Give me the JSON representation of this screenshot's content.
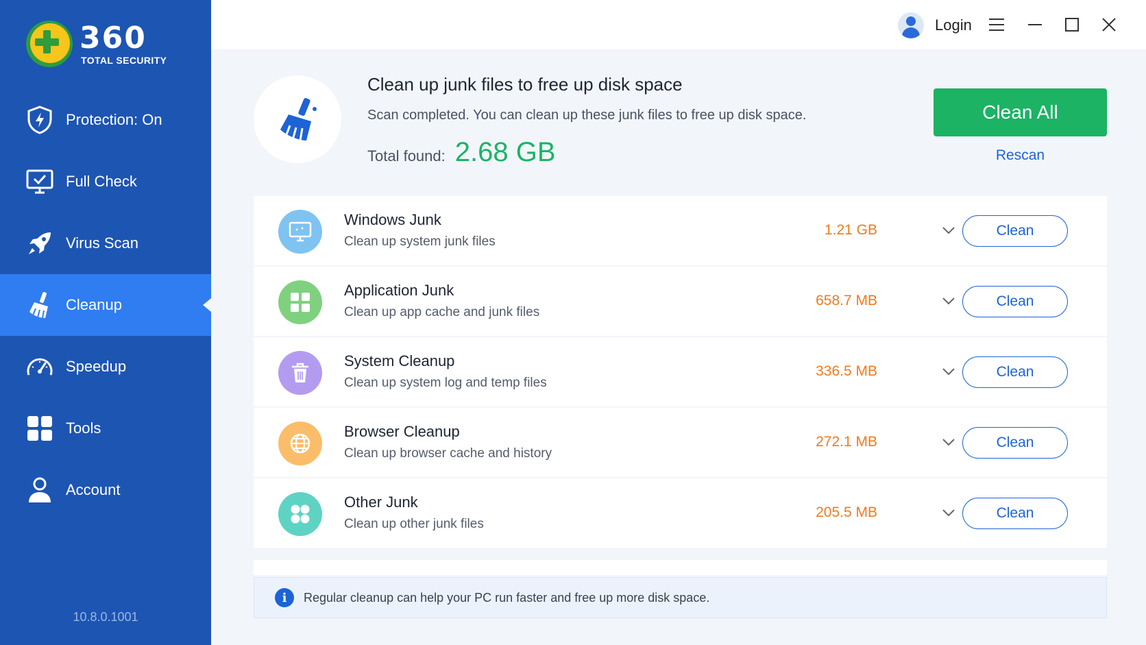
{
  "app": {
    "logo_number": "360",
    "logo_subtitle": "TOTAL SECURITY",
    "version": "10.8.0.1001"
  },
  "sidebar": {
    "items": [
      {
        "label": "Protection: On",
        "icon": "shield-bolt-icon",
        "active": false
      },
      {
        "label": "Full Check",
        "icon": "monitor-check-icon",
        "active": false
      },
      {
        "label": "Virus Scan",
        "icon": "rocket-icon",
        "active": false
      },
      {
        "label": "Cleanup",
        "icon": "broom-icon",
        "active": true
      },
      {
        "label": "Speedup",
        "icon": "speedometer-icon",
        "active": false
      },
      {
        "label": "Tools",
        "icon": "grid-icon",
        "active": false
      },
      {
        "label": "Account",
        "icon": "user-icon",
        "active": false
      }
    ]
  },
  "topbar": {
    "login_label": "Login"
  },
  "hero": {
    "title": "Clean up junk files to free up disk space",
    "description": "Scan completed. You can clean up these junk files to free up disk space.",
    "found_label": "Total found:",
    "found_value": "2.68 GB",
    "clean_all_label": "Clean All",
    "rescan_label": "Rescan"
  },
  "junk_list": [
    {
      "title": "Windows Junk",
      "description": "Clean up system junk files",
      "size": "1.21 GB",
      "button": "Clean",
      "icon": "monitor-icon",
      "color": "#7ec3f2"
    },
    {
      "title": "Application Junk",
      "description": "Clean up app cache and junk files",
      "size": "658.7 MB",
      "button": "Clean",
      "icon": "apps-grid-icon",
      "color": "#7fd17f"
    },
    {
      "title": "System Cleanup",
      "description": "Clean up system log and temp files",
      "size": "336.5 MB",
      "button": "Clean",
      "icon": "trash-icon",
      "color": "#b39cf0"
    },
    {
      "title": "Browser Cleanup",
      "description": "Clean up browser cache and history",
      "size": "272.1 MB",
      "button": "Clean",
      "icon": "globe-icon",
      "color": "#fbbd6a"
    },
    {
      "title": "Other Junk",
      "description": "Clean up other junk files",
      "size": "205.5 MB",
      "button": "Clean",
      "icon": "dots-grid-icon",
      "color": "#5fd3c3"
    }
  ],
  "notice": {
    "text": "Regular cleanup can help your PC run faster and free up more disk space."
  },
  "colors": {
    "sidebar": "#1d55b3",
    "sidebar_active": "#2f7df0",
    "accent_green": "#1cb364",
    "accent_blue": "#1d63d6",
    "size_orange": "#f27a1a"
  }
}
